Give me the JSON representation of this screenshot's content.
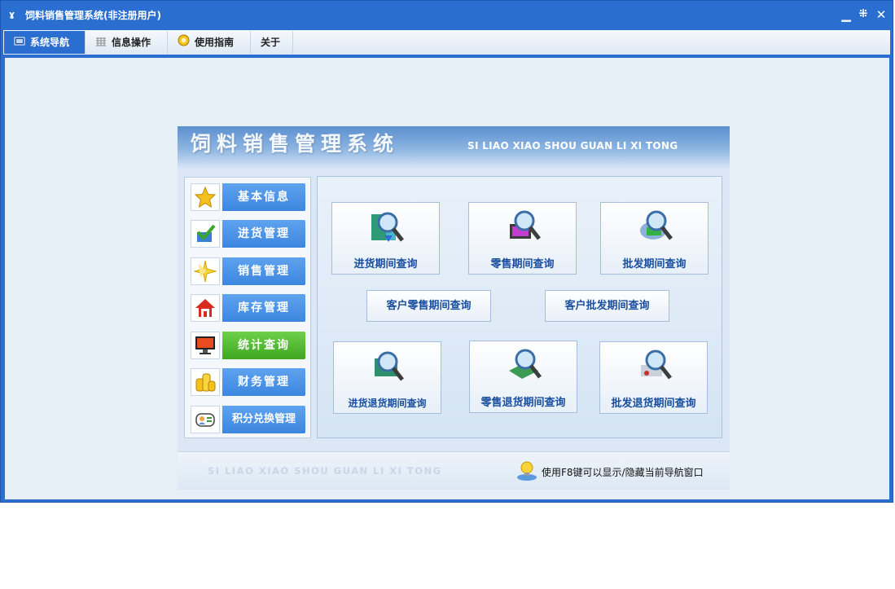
{
  "window": {
    "title": "饲料销售管理系统(非注册用户)"
  },
  "menubar": {
    "items": [
      {
        "label": "系统导航",
        "icon": "monitor-icon"
      },
      {
        "label": "信息操作",
        "icon": "grid-icon"
      },
      {
        "label": "使用指南",
        "icon": "help-icon"
      },
      {
        "label": "关于",
        "icon": ""
      }
    ]
  },
  "banner": {
    "title_cn": "饲料销售管理系统",
    "title_en": "SI LIAO XIAO SHOU GUAN LI XI TONG"
  },
  "sidebar": {
    "items": [
      {
        "label": "基本信息",
        "icon": "star-icon"
      },
      {
        "label": "进货管理",
        "icon": "check-icon"
      },
      {
        "label": "销售管理",
        "icon": "sparkle-icon"
      },
      {
        "label": "库存管理",
        "icon": "home-icon"
      },
      {
        "label": "统计查询",
        "icon": "monitor-icon"
      },
      {
        "label": "财务管理",
        "icon": "coins-icon"
      },
      {
        "label": "积分兑换管理",
        "icon": "contact-card-icon"
      }
    ]
  },
  "queries": {
    "purchase_period": "进货期间查询",
    "retail_period": "零售期间查询",
    "wholesale_period": "批发期间查询",
    "customer_retail": "客户零售期间查询",
    "customer_wholesale": "客户批发期间查询",
    "purchase_return": "进货退货期间查询",
    "retail_return": "零售退货期间查询",
    "wholesale_return": "批发退货期间查询"
  },
  "footer": {
    "title_en": "SI LIAO XIAO SHOU GUAN LI XI TONG",
    "tip": "使用F8键可以显示/隐藏当前导航窗口"
  },
  "colors": {
    "accent": "#2a6fd0",
    "nav_button": "#3c86e0",
    "nav_active": "#3ea61f"
  }
}
